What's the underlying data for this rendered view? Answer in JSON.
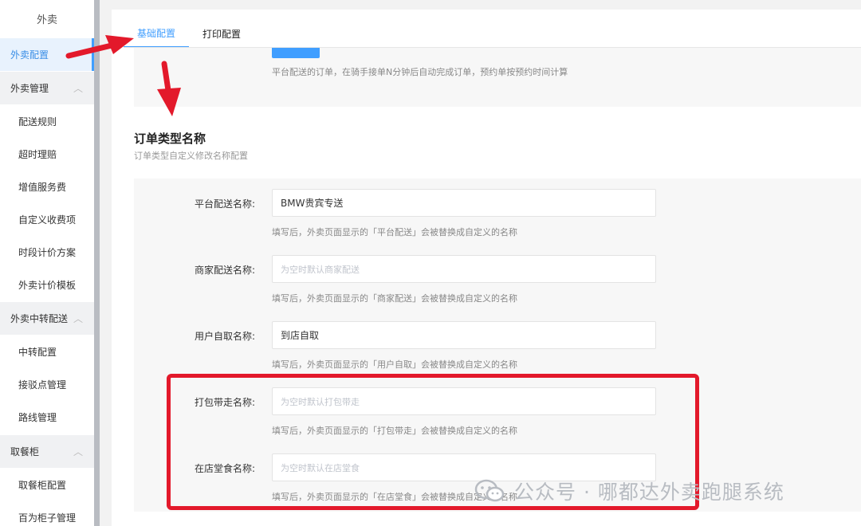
{
  "sidebar": {
    "title": "外卖",
    "active": "外卖配置",
    "groups": [
      {
        "label": "外卖管理",
        "items": [
          "配送规则",
          "超时理赔",
          "增值服务费",
          "自定义收费项",
          "时段计价方案",
          "外卖计价模板"
        ]
      },
      {
        "label": "外卖中转配送",
        "items": [
          "中转配置",
          "接驳点管理",
          "路线管理"
        ]
      },
      {
        "label": "取餐柜",
        "items": [
          "取餐柜配置",
          "百为柜子管理"
        ]
      }
    ]
  },
  "tabs": [
    "基础配置",
    "打印配置"
  ],
  "top": {
    "hint": "平台配送的订单，在骑手接单N分钟后自动完成订单，预约单按预约时间计算"
  },
  "section": {
    "title": "订单类型名称",
    "subtitle": "订单类型自定义修改名称配置"
  },
  "fields": [
    {
      "label": "平台配送名称:",
      "value": "BMW贵宾专送",
      "placeholder": "",
      "hint": "填写后，外卖页面显示的「平台配送」会被替换成自定义的名称"
    },
    {
      "label": "商家配送名称:",
      "value": "",
      "placeholder": "为空时默认商家配送",
      "hint": "填写后，外卖页面显示的「商家配送」会被替换成自定义的名称"
    },
    {
      "label": "用户自取名称:",
      "value": "到店自取",
      "placeholder": "",
      "hint": "填写后，外卖页面显示的「用户自取」会被替换成自定义的名称"
    },
    {
      "label": "打包带走名称:",
      "value": "",
      "placeholder": "为空时默认打包带走",
      "hint": "填写后，外卖页面显示的「打包带走」会被替换成自定义的名称"
    },
    {
      "label": "在店堂食名称:",
      "value": "",
      "placeholder": "为空时默认在店堂食",
      "hint": "填写后，外卖页面显示的「在店堂食」会被替换成自定义的名称"
    }
  ],
  "watermark": "公众号 · 哪都达外卖跑腿系统",
  "colors": {
    "accent": "#409eff",
    "highlight": "#e3192b",
    "annotation": "#e3192b"
  }
}
